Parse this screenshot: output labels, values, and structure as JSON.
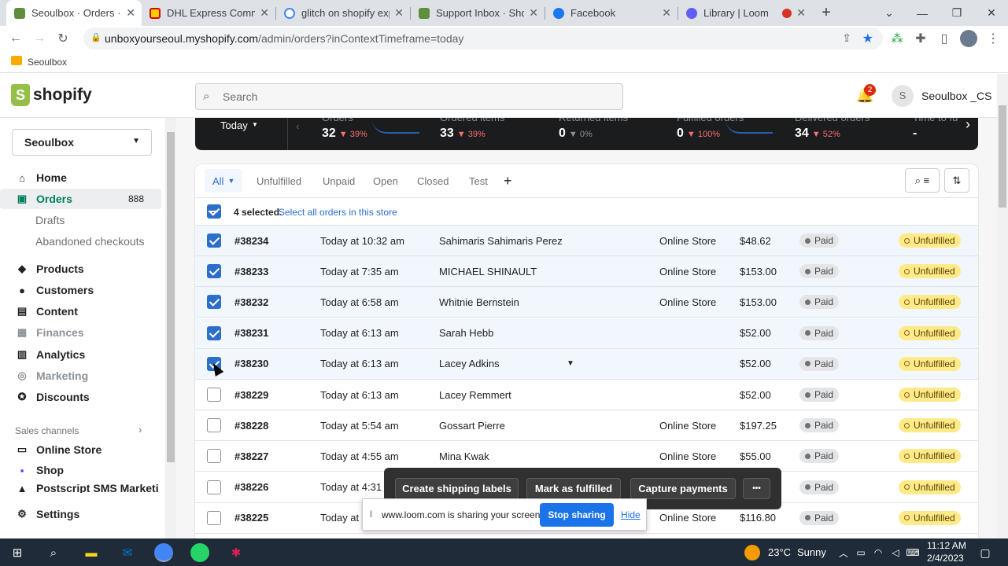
{
  "browser": {
    "tabs": [
      {
        "title": "Seoulbox · Orders · Shopify",
        "color": "#5e8e3e",
        "active": true
      },
      {
        "title": "DHL Express Commerce",
        "color": "#d40511",
        "active": false
      },
      {
        "title": "glitch on shopify export",
        "color": "#4285f4",
        "active": false
      },
      {
        "title": "Support Inbox · Shopify",
        "color": "#5e8e3e",
        "active": false
      },
      {
        "title": "Facebook",
        "color": "#1877f2",
        "active": false
      },
      {
        "title": "Library | Loom",
        "color": "#625df5",
        "active": false
      }
    ],
    "url_host": "unboxyourseoul.myshopify.com",
    "url_path": "/admin/orders?inContextTimeframe=today",
    "bookmark": "Seoulbox"
  },
  "shopify": {
    "logo": "shopify",
    "search_placeholder": "Search",
    "notifications": "2",
    "user_initial": "S",
    "user_name": "Seoulbox _CS",
    "store": "Seoulbox"
  },
  "sidebar": {
    "home": "Home",
    "orders": "Orders",
    "orders_count": "888",
    "drafts": "Drafts",
    "abandoned": "Abandoned checkouts",
    "products": "Products",
    "customers": "Customers",
    "content": "Content",
    "finances": "Finances",
    "analytics": "Analytics",
    "marketing": "Marketing",
    "discounts": "Discounts",
    "sales_channels": "Sales channels",
    "online_store": "Online Store",
    "shop": "Shop",
    "postscript": "Postscript SMS Marketi",
    "settings": "Settings"
  },
  "metrics": {
    "period": "Today",
    "items": [
      {
        "label": "Orders",
        "value": "32",
        "change": "39%",
        "dir": "down"
      },
      {
        "label": "Ordered items",
        "value": "33",
        "change": "39%",
        "dir": "down"
      },
      {
        "label": "Returned items",
        "value": "0",
        "change": "0%",
        "dir": "flat"
      },
      {
        "label": "Fulfilled orders",
        "value": "0",
        "change": "100%",
        "dir": "down"
      },
      {
        "label": "Delivered orders",
        "value": "34",
        "change": "52%",
        "dir": "down"
      },
      {
        "label": "Time to fu",
        "value": "-",
        "change": "",
        "dir": "none"
      }
    ]
  },
  "filters": {
    "tabs": [
      "All",
      "Unfulfilled",
      "Unpaid",
      "Open",
      "Closed",
      "Test"
    ],
    "add": "+"
  },
  "bulk": {
    "selected_text": "4 selected.",
    "select_all": "Select all orders in this store"
  },
  "orders": [
    {
      "id": "#38234",
      "date": "Today at 10:32 am",
      "customer": "Sahimaris Sahimaris Perez",
      "channel": "Online Store",
      "total": "$48.62",
      "payment": "Paid",
      "fulfillment": "Unfulfilled",
      "checked": true
    },
    {
      "id": "#38233",
      "date": "Today at 7:35 am",
      "customer": "MICHAEL SHINAULT",
      "channel": "Online Store",
      "total": "$153.00",
      "payment": "Paid",
      "fulfillment": "Unfulfilled",
      "checked": true
    },
    {
      "id": "#38232",
      "date": "Today at 6:58 am",
      "customer": "Whitnie Bernstein",
      "channel": "Online Store",
      "total": "$153.00",
      "payment": "Paid",
      "fulfillment": "Unfulfilled",
      "checked": true
    },
    {
      "id": "#38231",
      "date": "Today at 6:13 am",
      "customer": "Sarah Hebb",
      "channel": "",
      "total": "$52.00",
      "payment": "Paid",
      "fulfillment": "Unfulfilled",
      "checked": true
    },
    {
      "id": "#38230",
      "date": "Today at 6:13 am",
      "customer": "Lacey Adkins",
      "channel": "",
      "total": "$52.00",
      "payment": "Paid",
      "fulfillment": "Unfulfilled",
      "checked": true
    },
    {
      "id": "#38229",
      "date": "Today at 6:13 am",
      "customer": "Lacey Remmert",
      "channel": "",
      "total": "$52.00",
      "payment": "Paid",
      "fulfillment": "Unfulfilled",
      "checked": false
    },
    {
      "id": "#38228",
      "date": "Today at 5:54 am",
      "customer": "Gossart Pierre",
      "channel": "Online Store",
      "total": "$197.25",
      "payment": "Paid",
      "fulfillment": "Unfulfilled",
      "checked": false
    },
    {
      "id": "#38227",
      "date": "Today at 4:55 am",
      "customer": "Mina Kwak",
      "channel": "Online Store",
      "total": "$55.00",
      "payment": "Paid",
      "fulfillment": "Unfulfilled",
      "checked": false
    },
    {
      "id": "#38226",
      "date": "Today at 4:31",
      "customer": "",
      "channel": "",
      "total": "",
      "payment": "Paid",
      "fulfillment": "Unfulfilled",
      "checked": false
    },
    {
      "id": "#38225",
      "date": "Today at",
      "customer": "",
      "channel": "Online Store",
      "total": "$116.80",
      "payment": "Paid",
      "fulfillment": "Unfulfilled",
      "checked": false
    }
  ],
  "actionbar": {
    "shipping": "Create shipping labels",
    "fulfill": "Mark as fulfilled",
    "capture": "Capture payments",
    "more": "•••"
  },
  "loom": {
    "message": "www.loom.com is sharing your screen.",
    "stop": "Stop sharing",
    "hide": "Hide"
  },
  "taskbar": {
    "temp": "23°C",
    "weather": "Sunny",
    "time": "11:12 AM",
    "date": "2/4/2023"
  }
}
